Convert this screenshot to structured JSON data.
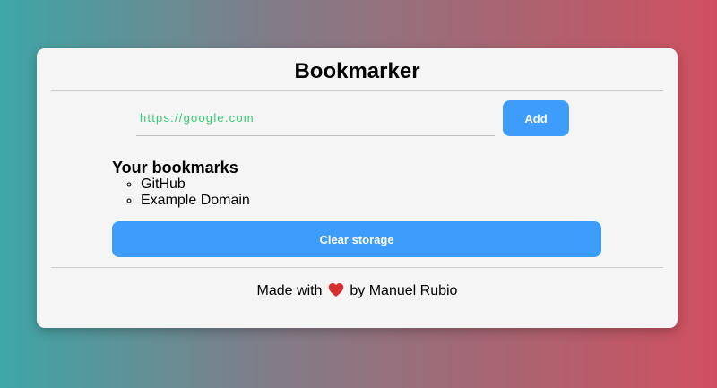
{
  "app": {
    "title": "Bookmarker"
  },
  "form": {
    "url_placeholder": "https://google.com",
    "add_label": "Add"
  },
  "bookmarks": {
    "heading": "Your bookmarks",
    "items": [
      {
        "label": "GitHub"
      },
      {
        "label": "Example Domain"
      }
    ],
    "clear_label": "Clear storage"
  },
  "footer": {
    "prefix": "Made with",
    "heart_icon": "heart-icon",
    "suffix": "by Manuel Rubio"
  },
  "colors": {
    "accent": "#3d9cfc",
    "input_text": "#2ecc71",
    "heart": "#d63031"
  }
}
